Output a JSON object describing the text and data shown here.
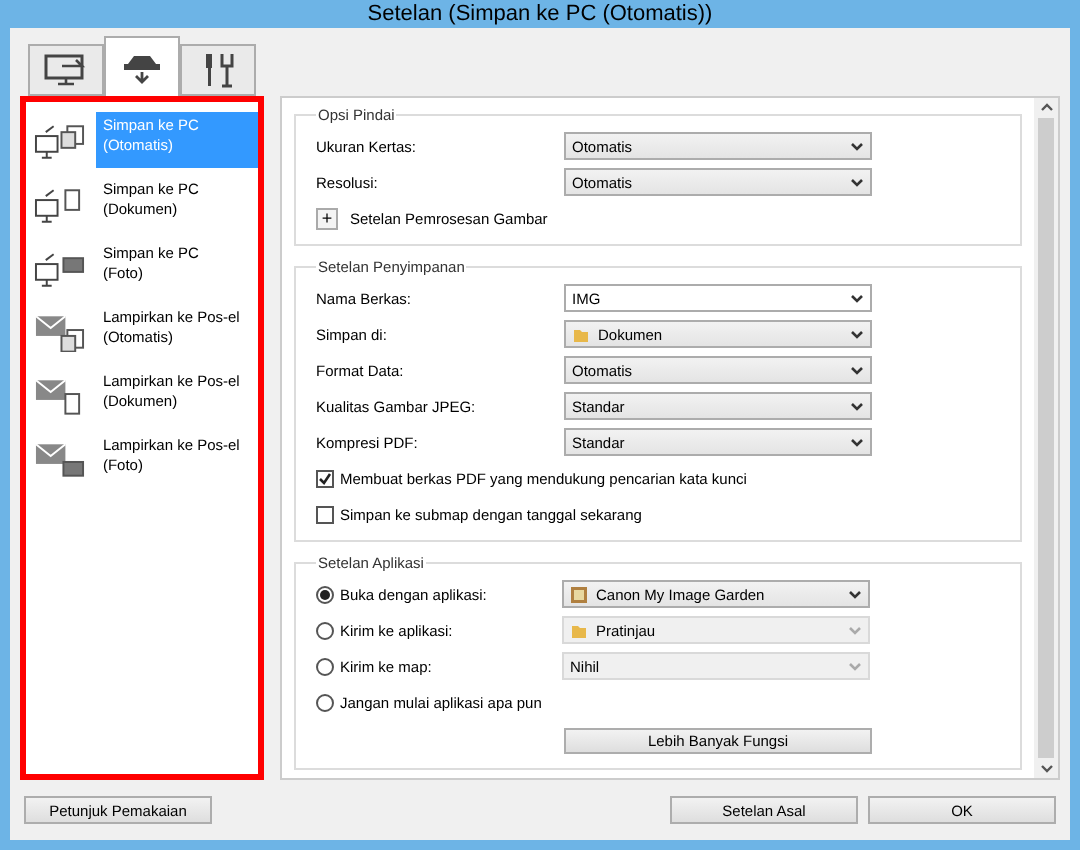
{
  "window": {
    "title": "Setelan (Simpan ke PC (Otomatis))"
  },
  "tabs": [
    {
      "selected": false
    },
    {
      "selected": true
    },
    {
      "selected": false
    }
  ],
  "sidebar": {
    "items": [
      {
        "label": "Simpan ke PC",
        "sub": "(Otomatis)",
        "selected": true
      },
      {
        "label": "Simpan ke PC",
        "sub": "(Dokumen)",
        "selected": false
      },
      {
        "label": "Simpan ke PC",
        "sub": "(Foto)",
        "selected": false
      },
      {
        "label": "Lampirkan ke Pos-el",
        "sub": "(Otomatis)",
        "selected": false
      },
      {
        "label": "Lampirkan ke Pos-el",
        "sub": "(Dokumen)",
        "selected": false
      },
      {
        "label": "Lampirkan ke Pos-el",
        "sub": "(Foto)",
        "selected": false
      }
    ]
  },
  "sections": [
    {
      "title": "Opsi Pindai",
      "rows": [
        {
          "kind": "select",
          "label": "Ukuran Kertas:",
          "value": "Otomatis"
        },
        {
          "kind": "select",
          "label": "Resolusi:",
          "value": "Otomatis"
        },
        {
          "kind": "expander",
          "symbol": "+",
          "label": "Setelan Pemrosesan Gambar"
        }
      ]
    },
    {
      "title": "Setelan Penyimpanan",
      "rows": [
        {
          "kind": "select",
          "label": "Nama Berkas:",
          "value": "IMG"
        },
        {
          "kind": "select",
          "label": "Simpan di:",
          "value": "Dokumen"
        },
        {
          "kind": "select",
          "label": "Format Data:",
          "value": "Otomatis"
        },
        {
          "kind": "select",
          "label": "Kualitas Gambar JPEG:",
          "value": "Standar"
        },
        {
          "kind": "select",
          "label": "Kompresi PDF:",
          "value": "Standar"
        },
        {
          "kind": "checkbox",
          "label": "Membuat berkas PDF yang mendukung pencarian kata kunci",
          "checked": true
        },
        {
          "kind": "checkbox",
          "label": "Simpan ke submap dengan tanggal sekarang",
          "checked": false
        }
      ]
    },
    {
      "title": "Setelan Aplikasi",
      "rows": [
        {
          "kind": "radio",
          "label": "Buka dengan aplikasi:",
          "selected": true,
          "value": "Canon My Image Garden",
          "disabled": false
        },
        {
          "kind": "radio",
          "label": "Kirim ke aplikasi:",
          "selected": false,
          "value": "Pratinjau",
          "disabled": true
        },
        {
          "kind": "radio",
          "label": "Kirim ke map:",
          "selected": false,
          "value": "Nihil",
          "disabled": true
        },
        {
          "kind": "radio",
          "label": "Jangan mulai aplikasi apa pun",
          "selected": false
        },
        {
          "kind": "button",
          "label": "Lebih Banyak Fungsi"
        }
      ]
    }
  ],
  "footer": {
    "help": "Petunjuk Pemakaian",
    "buttons": [
      "Setelan Asal",
      "OK"
    ]
  }
}
